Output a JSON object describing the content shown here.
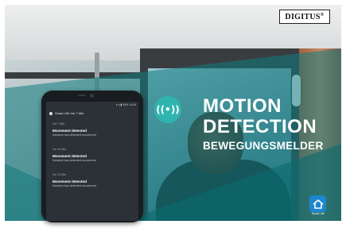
{
  "brand": {
    "logo_text": "DIGITUS",
    "trademark": "®"
  },
  "headline": {
    "line1": "MOTION",
    "line2": "DETECTION",
    "subtitle": "BEWEGUNGSMELDER"
  },
  "motion_icon_glyph": "((•))",
  "app_badge": {
    "label": "Smart Life",
    "color": "#1d86cf"
  },
  "phone": {
    "status_bar": "▾ ◂ ▮ 96% 14:49",
    "notification_header": "Smart Life  Vor 7 Min.",
    "notifications": [
      {
        "time": "Vor 7 Min.",
        "title": "Movement detected",
        "body": "Kamera has detected movement"
      },
      {
        "time": "Vor 19 Min.",
        "title": "Movement detected",
        "body": "Kamera has detected movement"
      },
      {
        "time": "Vor 22 Min.",
        "title": "Movement detected",
        "body": "Kamera has detected movement"
      }
    ]
  },
  "colors": {
    "teal_overlay": "#1a8a8c",
    "accent": "#2fb4b0"
  }
}
